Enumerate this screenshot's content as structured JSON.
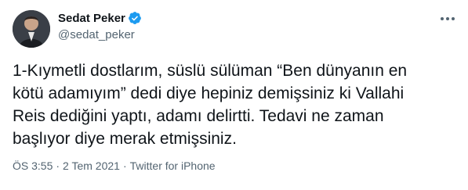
{
  "author": {
    "display_name": "Sedat Peker",
    "handle": "@sedat_peker",
    "verified": true
  },
  "tweet": {
    "text": "1-Kıymetli dostlarım, süslü sülüman “Ben dünyanın en\nkötü adamıyım” dedi diye hepiniz demişsiniz ki Vallahi\nReis dediğini yaptı, adamı delirtti. Tedavi ne zaman\nbaşlıyor diye merak etmişsiniz."
  },
  "meta": {
    "time": "ÖS 3:55",
    "separator": "·",
    "date": "2 Tem 2021",
    "source": "Twitter for iPhone"
  },
  "colors": {
    "verified_badge": "#1d9bf0",
    "secondary_text": "#536471",
    "primary_text": "#0f1419"
  }
}
